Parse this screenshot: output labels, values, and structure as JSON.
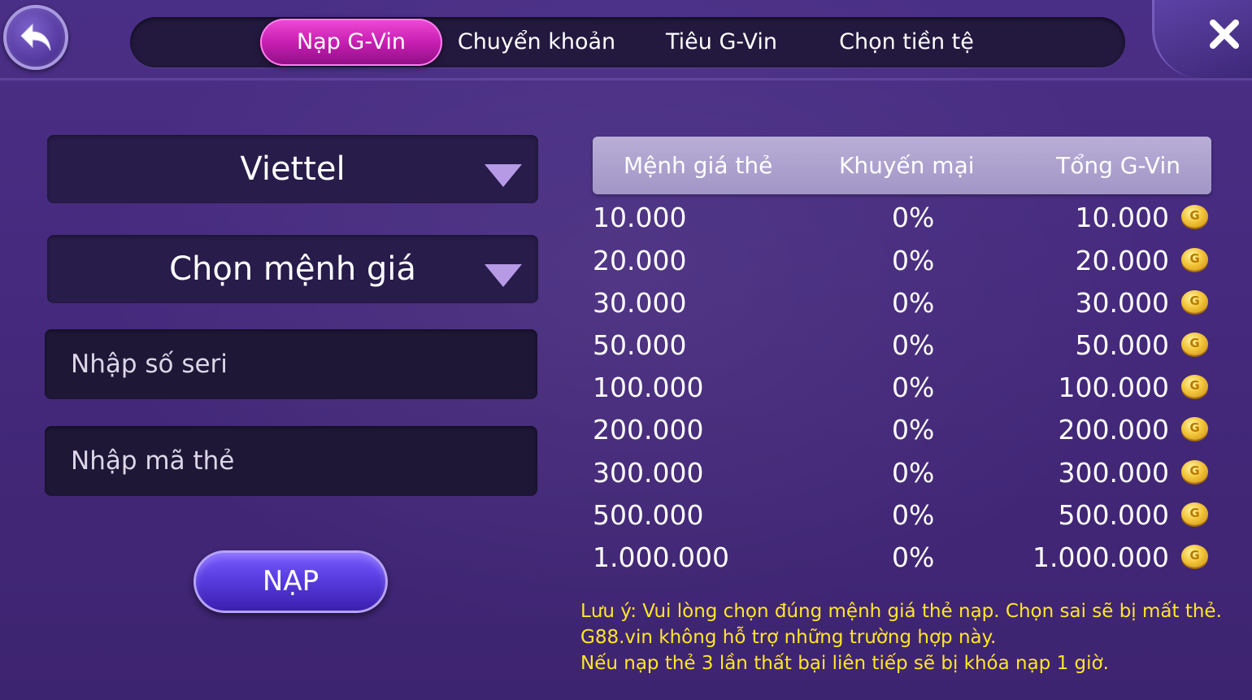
{
  "tabs": [
    {
      "label": "Nạp G-Vin",
      "active": true
    },
    {
      "label": "Chuyển khoản",
      "active": false
    },
    {
      "label": "Tiêu G-Vin",
      "active": false
    },
    {
      "label": "Chọn tiền tệ",
      "active": false
    }
  ],
  "form": {
    "carrier_select": "Viettel",
    "denomination_select": "Chọn mệnh giá",
    "serial_placeholder": "Nhập số seri",
    "code_placeholder": "Nhập mã thẻ",
    "submit_label": "NẠP"
  },
  "table": {
    "headers": [
      "Mệnh giá thẻ",
      "Khuyến mại",
      "Tổng G-Vin"
    ],
    "rows": [
      {
        "value": "10.000",
        "promo": "0%",
        "total": "10.000"
      },
      {
        "value": "20.000",
        "promo": "0%",
        "total": "20.000"
      },
      {
        "value": "30.000",
        "promo": "0%",
        "total": "30.000"
      },
      {
        "value": "50.000",
        "promo": "0%",
        "total": "50.000"
      },
      {
        "value": "100.000",
        "promo": "0%",
        "total": "100.000"
      },
      {
        "value": "200.000",
        "promo": "0%",
        "total": "200.000"
      },
      {
        "value": "300.000",
        "promo": "0%",
        "total": "300.000"
      },
      {
        "value": "500.000",
        "promo": "0%",
        "total": "500.000"
      },
      {
        "value": "1.000.000",
        "promo": "0%",
        "total": "1.000.000"
      }
    ]
  },
  "notes": [
    "Lưu ý: Vui lòng chọn đúng mệnh giá thẻ nạp. Chọn sai sẽ bị mất thẻ.",
    "G88.vin không hỗ trợ những trường hợp này.",
    "Nếu nạp thẻ 3 lần thất bại liên tiếp sẽ bị khóa nạp 1 giờ."
  ],
  "icons": {
    "back": "back-arrow-icon",
    "close": "close-icon",
    "dropdown": "triangle-down-icon",
    "coin": "coin-icon"
  },
  "colors": {
    "background": "#45297c",
    "active_tab": "#c71fb2",
    "note_text": "#ffe62a",
    "table_header": "#a296c6"
  }
}
